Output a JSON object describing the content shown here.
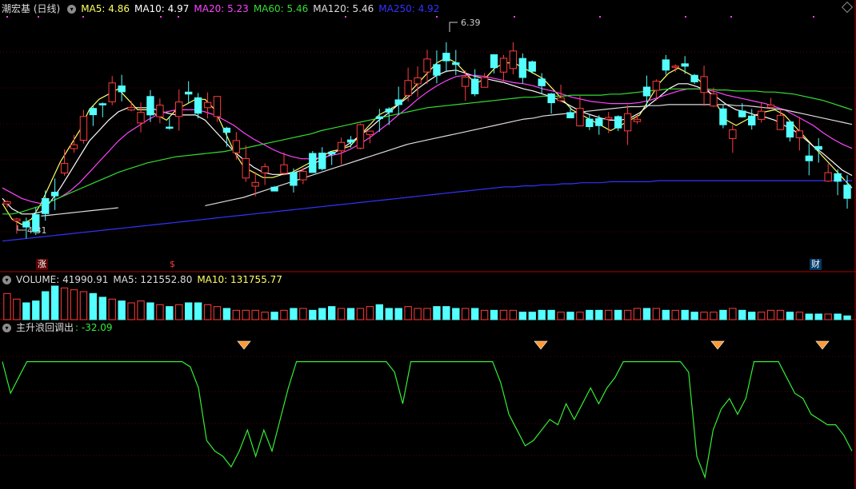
{
  "main_header": {
    "title": "潮宏基 (日线)",
    "ma5": "MA5: 4.86",
    "ma10": "MA10: 4.97",
    "ma20": "MA20: 5.23",
    "ma60": "MA60: 5.46",
    "ma120": "MA120: 5.46",
    "ma250": "MA250: 4.92"
  },
  "high_label": "6.39",
  "low_label": "4.31",
  "event_tags": [
    "涨",
    "$",
    "财"
  ],
  "volume_header": {
    "volume": "VOLUME: 41990.91",
    "ma5": "MA5: 121552.80",
    "ma10": "MA10: 131755.77"
  },
  "indicator_header": {
    "name": "主升浪回调出",
    "value": ": -32.09"
  },
  "colors": {
    "up": "#ff3c3c",
    "down": "#54ffff",
    "ma5": "#ffff66",
    "ma10": "#ffffff",
    "ma20": "#ff44ff",
    "ma60": "#33dd33",
    "ma120": "#dddddd",
    "ma250": "#3333ff",
    "indicator": "#33ee33",
    "diamond": "#ff9933"
  },
  "chart_data": {
    "type": "candlestick",
    "price_range": [
      4.2,
      6.5
    ],
    "series": [
      {
        "name": "MA5",
        "values": [
          4.7,
          4.55,
          4.5,
          4.55,
          4.7,
          4.9,
          5.1,
          5.25,
          5.4,
          5.6,
          5.7,
          5.75,
          5.8,
          5.7,
          5.6,
          5.6,
          5.55,
          5.5,
          5.6,
          5.65,
          5.7,
          5.7,
          5.6,
          5.4,
          5.2,
          5.05,
          5.0,
          4.95,
          4.95,
          4.98,
          5.0,
          5.05,
          5.1,
          5.15,
          5.2,
          5.22,
          5.25,
          5.35,
          5.45,
          5.55,
          5.6,
          5.65,
          5.75,
          5.85,
          5.95,
          6.05,
          6.1,
          6.05,
          5.95,
          5.85,
          5.9,
          6.0,
          6.05,
          6.05,
          6.0,
          5.95,
          5.9,
          5.8,
          5.7,
          5.6,
          5.55,
          5.5,
          5.45,
          5.4,
          5.45,
          5.5,
          5.55,
          5.7,
          5.85,
          5.95,
          6.0,
          5.95,
          5.9,
          5.8,
          5.65,
          5.5,
          5.45,
          5.5,
          5.55,
          5.58,
          5.6,
          5.55,
          5.45,
          5.35,
          5.25,
          5.15,
          5.05,
          4.95,
          4.85
        ]
      },
      {
        "name": "MA10",
        "values": [
          4.75,
          4.65,
          4.6,
          4.6,
          4.62,
          4.72,
          4.85,
          5.0,
          5.15,
          5.3,
          5.4,
          5.5,
          5.58,
          5.62,
          5.62,
          5.62,
          5.6,
          5.57,
          5.55,
          5.55,
          5.55,
          5.5,
          5.4,
          5.3,
          5.2,
          5.12,
          5.05,
          5.0,
          4.98,
          4.98,
          4.99,
          5.02,
          5.07,
          5.12,
          5.17,
          5.22,
          5.28,
          5.35,
          5.42,
          5.5,
          5.57,
          5.65,
          5.72,
          5.8,
          5.87,
          5.93,
          5.97,
          5.98,
          5.95,
          5.92,
          5.9,
          5.88,
          5.86,
          5.83,
          5.8,
          5.78,
          5.75,
          5.72,
          5.68,
          5.63,
          5.58,
          5.55,
          5.52,
          5.5,
          5.5,
          5.52,
          5.57,
          5.65,
          5.72,
          5.8,
          5.85,
          5.85,
          5.82,
          5.78,
          5.72,
          5.65,
          5.6,
          5.58,
          5.55,
          5.53,
          5.5,
          5.45,
          5.4,
          5.33,
          5.25,
          5.18,
          5.1,
          5.02,
          4.97
        ]
      },
      {
        "name": "MA20",
        "values": [
          4.85,
          4.8,
          4.75,
          4.72,
          4.7,
          4.72,
          4.76,
          4.82,
          4.9,
          5.0,
          5.1,
          5.2,
          5.3,
          5.38,
          5.44,
          5.5,
          5.55,
          5.58,
          5.6,
          5.6,
          5.6,
          5.58,
          5.55,
          5.5,
          5.45,
          5.38,
          5.32,
          5.27,
          5.22,
          5.18,
          5.15,
          5.13,
          5.13,
          5.14,
          5.16,
          5.18,
          5.22,
          5.27,
          5.33,
          5.4,
          5.47,
          5.55,
          5.62,
          5.7,
          5.77,
          5.83,
          5.88,
          5.92,
          5.93,
          5.93,
          5.92,
          5.9,
          5.88,
          5.86,
          5.85,
          5.83,
          5.8,
          5.78,
          5.75,
          5.72,
          5.7,
          5.68,
          5.67,
          5.66,
          5.66,
          5.66,
          5.67,
          5.69,
          5.72,
          5.75,
          5.78,
          5.8,
          5.8,
          5.79,
          5.77,
          5.74,
          5.72,
          5.7,
          5.68,
          5.66,
          5.63,
          5.6,
          5.55,
          5.5,
          5.45,
          5.38,
          5.32,
          5.27,
          5.23
        ]
      },
      {
        "name": "MA60",
        "values": [
          4.6,
          4.6,
          4.62,
          4.65,
          4.68,
          4.72,
          4.76,
          4.8,
          4.84,
          4.88,
          4.92,
          4.96,
          5.0,
          5.03,
          5.06,
          5.09,
          5.11,
          5.13,
          5.15,
          5.16,
          5.17,
          5.18,
          5.19,
          5.2,
          5.22,
          5.23,
          5.25,
          5.27,
          5.29,
          5.31,
          5.33,
          5.35,
          5.37,
          5.4,
          5.42,
          5.44,
          5.46,
          5.48,
          5.5,
          5.52,
          5.54,
          5.56,
          5.58,
          5.6,
          5.62,
          5.63,
          5.64,
          5.65,
          5.66,
          5.67,
          5.68,
          5.69,
          5.7,
          5.71,
          5.72,
          5.72,
          5.73,
          5.73,
          5.73,
          5.74,
          5.74,
          5.74,
          5.74,
          5.75,
          5.75,
          5.76,
          5.77,
          5.78,
          5.79,
          5.8,
          5.8,
          5.8,
          5.8,
          5.8,
          5.79,
          5.79,
          5.78,
          5.78,
          5.78,
          5.77,
          5.77,
          5.76,
          5.75,
          5.73,
          5.71,
          5.69,
          5.66,
          5.63,
          5.6
        ]
      },
      {
        "name": "MA120",
        "values": [
          null,
          null,
          null,
          null,
          4.58,
          4.59,
          4.6,
          4.61,
          4.62,
          4.63,
          4.64,
          4.65,
          4.66,
          null,
          null,
          null,
          null,
          null,
          null,
          null,
          null,
          4.68,
          4.7,
          4.72,
          4.74,
          4.76,
          4.79,
          4.82,
          4.85,
          4.88,
          4.91,
          4.94,
          4.97,
          5.0,
          5.03,
          5.06,
          5.09,
          5.12,
          5.15,
          5.18,
          5.21,
          5.24,
          5.27,
          5.29,
          5.31,
          5.33,
          5.35,
          5.37,
          5.39,
          5.41,
          5.43,
          5.45,
          5.47,
          5.49,
          5.51,
          5.52,
          5.54,
          5.55,
          5.56,
          5.57,
          5.58,
          5.59,
          5.6,
          5.61,
          5.62,
          5.63,
          5.63,
          5.64,
          5.64,
          5.65,
          5.65,
          5.65,
          5.65,
          5.65,
          5.65,
          5.65,
          5.64,
          5.64,
          5.63,
          5.62,
          5.61,
          5.6,
          5.58,
          5.56,
          5.54,
          5.52,
          5.5,
          5.48,
          5.46
        ]
      },
      {
        "name": "MA250",
        "values": [
          4.34,
          4.35,
          4.36,
          4.37,
          4.38,
          4.39,
          4.4,
          4.41,
          4.42,
          4.43,
          4.44,
          4.45,
          4.46,
          4.47,
          4.48,
          4.49,
          4.5,
          4.51,
          4.52,
          4.53,
          4.54,
          4.55,
          4.56,
          4.57,
          4.58,
          4.59,
          4.6,
          4.61,
          4.62,
          4.63,
          4.64,
          4.65,
          4.66,
          4.67,
          4.68,
          4.69,
          4.7,
          4.71,
          4.72,
          4.73,
          4.74,
          4.75,
          4.76,
          4.77,
          4.78,
          4.79,
          4.8,
          4.81,
          4.82,
          4.83,
          4.84,
          4.85,
          4.86,
          4.86,
          4.87,
          4.87,
          4.88,
          4.88,
          4.89,
          4.89,
          4.9,
          4.9,
          4.9,
          4.91,
          4.91,
          4.91,
          4.91,
          4.91,
          4.92,
          4.92,
          4.92,
          4.92,
          4.92,
          4.92,
          4.92,
          4.92,
          4.92,
          4.92,
          4.92,
          4.92,
          4.92,
          4.92,
          4.92,
          4.92,
          4.92,
          4.92,
          4.92,
          4.92,
          4.92
        ]
      }
    ],
    "volume": [
      1.4,
      1.1,
      0.9,
      1.0,
      1.5,
      1.8,
      1.7,
      1.6,
      1.5,
      1.4,
      1.2,
      1.1,
      1.0,
      0.9,
      1.0,
      0.9,
      0.8,
      0.7,
      0.8,
      0.9,
      0.9,
      0.8,
      0.7,
      0.6,
      0.5,
      0.5,
      0.5,
      0.4,
      0.4,
      0.5,
      0.6,
      0.6,
      0.5,
      0.6,
      0.7,
      0.6,
      0.6,
      0.6,
      0.7,
      0.8,
      0.6,
      0.6,
      0.7,
      0.6,
      0.6,
      0.7,
      0.7,
      0.6,
      0.6,
      0.6,
      0.5,
      0.5,
      0.5,
      0.5,
      0.4,
      0.4,
      0.5,
      0.5,
      0.4,
      0.4,
      0.4,
      0.5,
      0.5,
      0.5,
      0.5,
      0.5,
      0.6,
      0.6,
      0.6,
      0.5,
      0.5,
      0.5,
      0.4,
      0.4,
      0.4,
      0.5,
      0.6,
      0.5,
      0.4,
      0.4,
      0.5,
      0.5,
      0.4,
      0.4,
      0.3,
      0.3,
      0.3,
      0.3,
      0.2
    ],
    "indicator": [
      -5,
      -35,
      -20,
      -5,
      -5,
      -5,
      -5,
      -5,
      -5,
      -5,
      -5,
      -5,
      -5,
      -5,
      -5,
      -5,
      -5,
      -5,
      -5,
      -5,
      -5,
      -5,
      -5,
      -10,
      -30,
      -80,
      -90,
      -95,
      -105,
      -90,
      -70,
      -95,
      -70,
      -90,
      -60,
      -30,
      -5,
      -5,
      -5,
      -5,
      -5,
      -5,
      -5,
      -5,
      -5,
      -5,
      -5,
      -5,
      -15,
      -45,
      -5,
      -5,
      -5,
      -5,
      -5,
      -5,
      -5,
      -5,
      -5,
      -5,
      -5,
      -25,
      -55,
      -70,
      -85,
      -80,
      -70,
      -60,
      -65,
      -45,
      -60,
      -45,
      -30,
      -45,
      -30,
      -20,
      -5,
      -5,
      -5,
      -5,
      -5,
      -5,
      -5,
      -5,
      -15,
      -95,
      -115,
      -70,
      -50,
      -40,
      -55,
      -40,
      -5,
      -5,
      -5,
      -5,
      -20,
      -35,
      -40,
      -55,
      -60,
      -65,
      -65,
      -75,
      -90
    ]
  }
}
